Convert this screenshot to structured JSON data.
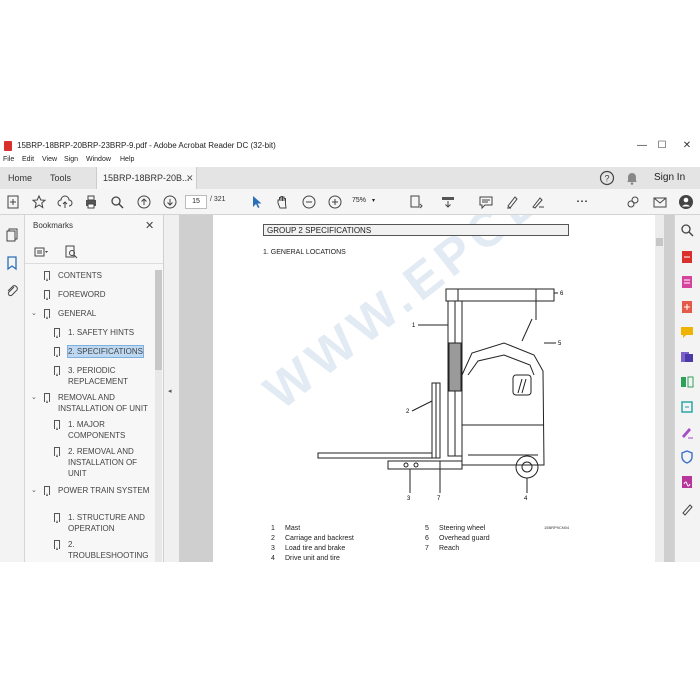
{
  "window": {
    "title": "15BRP-18BRP-20BRP-23BRP-9.pdf - Adobe Acrobat Reader DC (32-bit)",
    "controls": [
      "—",
      "☐",
      "✕"
    ]
  },
  "menu": [
    "File",
    "Edit",
    "View",
    "Sign",
    "Window",
    "Help"
  ],
  "tabs": {
    "home": "Home",
    "tools": "Tools",
    "document": "15BRP-18BRP-20B...",
    "signin": "Sign In"
  },
  "toolbar": {
    "page_current": "15",
    "page_total": "/ 321",
    "zoom": "75%"
  },
  "bookmarks": {
    "heading": "Bookmarks",
    "items": [
      {
        "label": "CONTENTS",
        "level": 0,
        "chevron": ""
      },
      {
        "label": "FOREWORD",
        "level": 0,
        "chevron": ""
      },
      {
        "label": "GENERAL",
        "level": 0,
        "chevron": "⌄"
      },
      {
        "label": "1. SAFETY HINTS",
        "level": 1,
        "chevron": ""
      },
      {
        "label": "2. SPECIFICATIONS",
        "level": 1,
        "chevron": "",
        "selected": true
      },
      {
        "label": "3. PERIODIC\nREPLACEMENT",
        "level": 1,
        "chevron": ""
      },
      {
        "label": "REMOVAL AND\nINSTALLATION OF UNIT",
        "level": 0,
        "chevron": "⌄"
      },
      {
        "label": "1. MAJOR\nCOMPONENTS",
        "level": 1,
        "chevron": ""
      },
      {
        "label": "2. REMOVAL AND\nINSTALLATION OF\nUNIT",
        "level": 1,
        "chevron": ""
      },
      {
        "label": "POWER TRAIN SYSTEM",
        "level": 0,
        "chevron": "⌄"
      },
      {
        "label": "1. STRUCTURE AND\nOPERATION",
        "level": 1,
        "chevron": ""
      },
      {
        "label": "2.\nTROUBLESHOOTING",
        "level": 1,
        "chevron": ""
      }
    ]
  },
  "document": {
    "group_heading": "GROUP 2  SPECIFICATIONS",
    "section_title": "1. GENERAL LOCATIONS",
    "callouts": [
      "1",
      "2",
      "3",
      "4",
      "5",
      "6",
      "7"
    ],
    "drawing_ref": "15BRP9CN04",
    "legend_left": [
      {
        "num": "1",
        "label": "Mast"
      },
      {
        "num": "2",
        "label": "Carriage and backrest"
      },
      {
        "num": "3",
        "label": "Load tire and brake"
      },
      {
        "num": "4",
        "label": "Drive unit and tire"
      }
    ],
    "legend_right": [
      {
        "num": "5",
        "label": "Steering wheel"
      },
      {
        "num": "6",
        "label": "Overhead guard"
      },
      {
        "num": "7",
        "label": "Reach"
      }
    ],
    "watermark": "WWW.EPCDEPO.COM"
  }
}
